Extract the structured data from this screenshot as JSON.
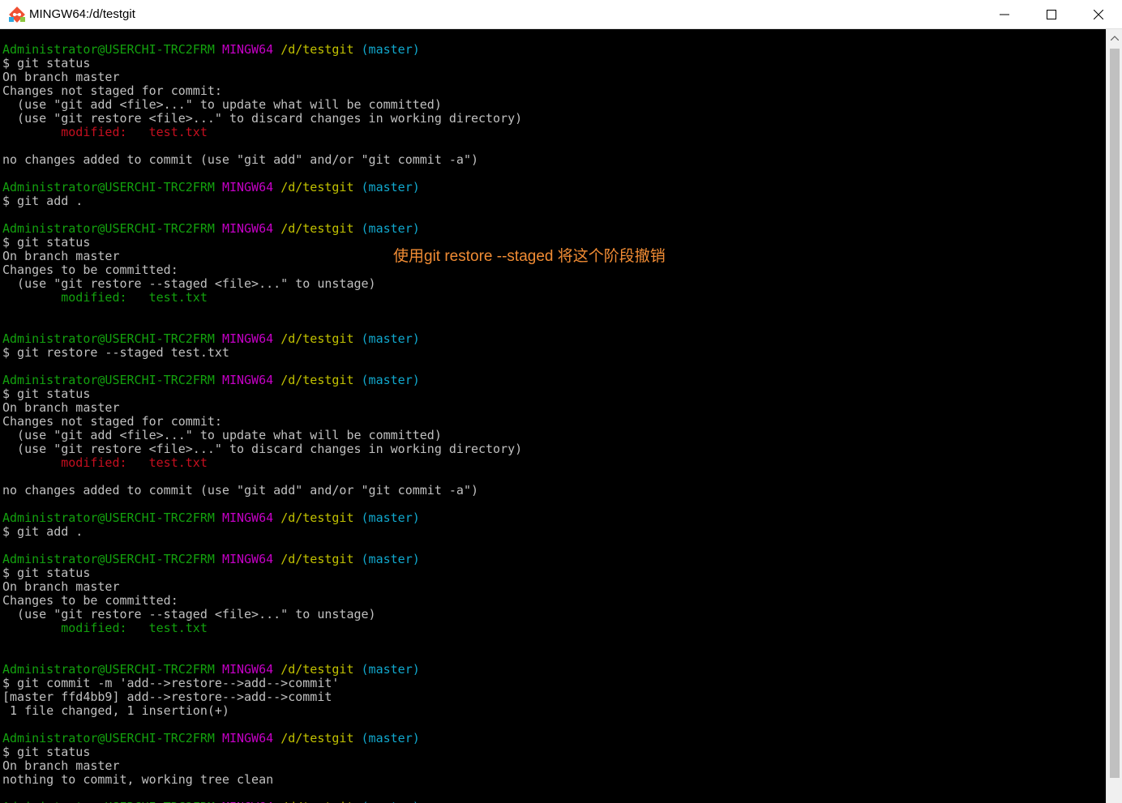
{
  "window": {
    "title": "MINGW64:/d/testgit",
    "app_icon": "git-bash-icon"
  },
  "colors": {
    "user": "#13a10e",
    "system": "#c500c5",
    "path": "#c1c100",
    "branch": "#11a8cd",
    "modified_unstaged": "#c50f1f",
    "modified_staged": "#13a10e",
    "annotation": "#f18c34"
  },
  "prompt": {
    "user_host": "Administrator@USERCHI-TRC2FRM",
    "system": "MINGW64",
    "path": "/d/testgit",
    "branch": "(master)"
  },
  "terminal_lines": [
    {
      "type": "prompt"
    },
    {
      "type": "text",
      "text": "$ git status"
    },
    {
      "type": "text",
      "text": "On branch master"
    },
    {
      "type": "text",
      "text": "Changes not staged for commit:"
    },
    {
      "type": "text",
      "text": "  (use \"git add <file>...\" to update what will be committed)"
    },
    {
      "type": "text",
      "text": "  (use \"git restore <file>...\" to discard changes in working directory)"
    },
    {
      "type": "colored",
      "color": "red",
      "text": "        modified:   test.txt"
    },
    {
      "type": "blank"
    },
    {
      "type": "text",
      "text": "no changes added to commit (use \"git add\" and/or \"git commit -a\")"
    },
    {
      "type": "blank"
    },
    {
      "type": "prompt"
    },
    {
      "type": "text",
      "text": "$ git add ."
    },
    {
      "type": "blank"
    },
    {
      "type": "prompt"
    },
    {
      "type": "text",
      "text": "$ git status"
    },
    {
      "type": "text",
      "text": "On branch master"
    },
    {
      "type": "text",
      "text": "Changes to be committed:"
    },
    {
      "type": "text",
      "text": "  (use \"git restore --staged <file>...\" to unstage)"
    },
    {
      "type": "colored",
      "color": "green",
      "text": "        modified:   test.txt"
    },
    {
      "type": "blank"
    },
    {
      "type": "blank"
    },
    {
      "type": "prompt"
    },
    {
      "type": "text",
      "text": "$ git restore --staged test.txt"
    },
    {
      "type": "blank"
    },
    {
      "type": "prompt"
    },
    {
      "type": "text",
      "text": "$ git status"
    },
    {
      "type": "text",
      "text": "On branch master"
    },
    {
      "type": "text",
      "text": "Changes not staged for commit:"
    },
    {
      "type": "text",
      "text": "  (use \"git add <file>...\" to update what will be committed)"
    },
    {
      "type": "text",
      "text": "  (use \"git restore <file>...\" to discard changes in working directory)"
    },
    {
      "type": "colored",
      "color": "red",
      "text": "        modified:   test.txt"
    },
    {
      "type": "blank"
    },
    {
      "type": "text",
      "text": "no changes added to commit (use \"git add\" and/or \"git commit -a\")"
    },
    {
      "type": "blank"
    },
    {
      "type": "prompt"
    },
    {
      "type": "text",
      "text": "$ git add ."
    },
    {
      "type": "blank"
    },
    {
      "type": "prompt"
    },
    {
      "type": "text",
      "text": "$ git status"
    },
    {
      "type": "text",
      "text": "On branch master"
    },
    {
      "type": "text",
      "text": "Changes to be committed:"
    },
    {
      "type": "text",
      "text": "  (use \"git restore --staged <file>...\" to unstage)"
    },
    {
      "type": "colored",
      "color": "green",
      "text": "        modified:   test.txt"
    },
    {
      "type": "blank"
    },
    {
      "type": "blank"
    },
    {
      "type": "prompt"
    },
    {
      "type": "text",
      "text": "$ git commit -m 'add-->restore-->add-->commit'"
    },
    {
      "type": "text",
      "text": "[master ffd4bb9] add-->restore-->add-->commit"
    },
    {
      "type": "text",
      "text": " 1 file changed, 1 insertion(+)"
    },
    {
      "type": "blank"
    },
    {
      "type": "prompt"
    },
    {
      "type": "text",
      "text": "$ git status"
    },
    {
      "type": "text",
      "text": "On branch master"
    },
    {
      "type": "text",
      "text": "nothing to commit, working tree clean"
    },
    {
      "type": "blank"
    },
    {
      "type": "prompt"
    }
  ],
  "annotation": {
    "text": "使用git restore --staged 将这个阶段撤销"
  }
}
